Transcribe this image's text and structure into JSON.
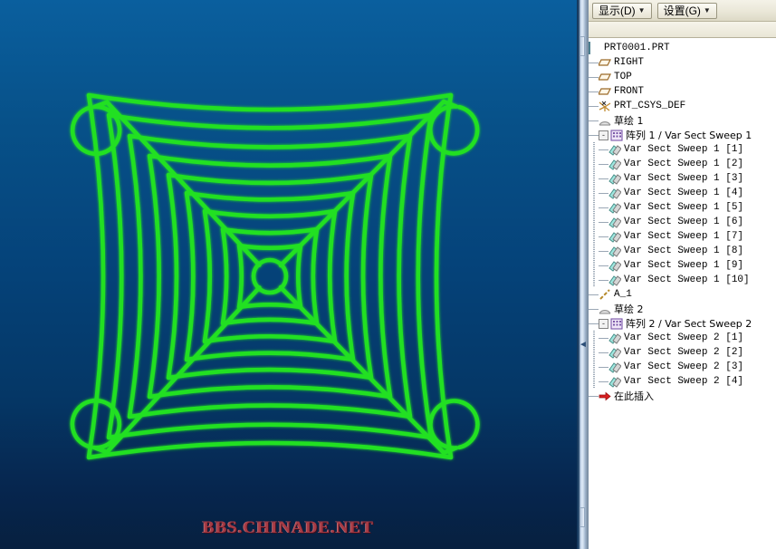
{
  "app": {
    "watermark": "BBS.CHINADE.NET",
    "viewport_name": "3d-graphics-view",
    "model_description": "green spider web swept feature"
  },
  "colors": {
    "background_top": "#0a5f9e",
    "background_bottom": "#07203f",
    "geometry_green": "#22e022",
    "watermark_red": "#a53a44",
    "panel_background": "#ffffff",
    "toolbar_background": "#eae7d8"
  },
  "toolbar": {
    "buttons": [
      {
        "label": "显示(D)",
        "caret": "▼",
        "name": "display-menu-button"
      },
      {
        "label": "设置(G)",
        "caret": "▼",
        "name": "settings-menu-button"
      }
    ]
  },
  "tree": {
    "items": [
      {
        "label": "PRT0001.PRT",
        "depth": 0,
        "icon": "part-icon",
        "expander": "",
        "mono": true
      },
      {
        "label": "RIGHT",
        "depth": 1,
        "icon": "plane-icon",
        "expander": "",
        "mono": true
      },
      {
        "label": "TOP",
        "depth": 1,
        "icon": "plane-icon",
        "expander": "",
        "mono": true
      },
      {
        "label": "FRONT",
        "depth": 1,
        "icon": "plane-icon",
        "expander": "",
        "mono": true
      },
      {
        "label": "PRT_CSYS_DEF",
        "depth": 1,
        "icon": "csys-icon",
        "expander": "",
        "mono": true
      },
      {
        "label": "草绘 1",
        "depth": 1,
        "icon": "sketch-icon",
        "expander": "",
        "mono": false
      },
      {
        "label": "阵列 1 / Var Sect Sweep 1",
        "depth": 1,
        "icon": "pattern-icon",
        "expander": "-",
        "mono": false
      },
      {
        "label": "Var Sect Sweep 1 [1]",
        "depth": 2,
        "icon": "sweep-icon",
        "expander": "",
        "mono": true
      },
      {
        "label": "Var Sect Sweep 1 [2]",
        "depth": 2,
        "icon": "sweep-icon",
        "expander": "",
        "mono": true
      },
      {
        "label": "Var Sect Sweep 1 [3]",
        "depth": 2,
        "icon": "sweep-icon",
        "expander": "",
        "mono": true
      },
      {
        "label": "Var Sect Sweep 1 [4]",
        "depth": 2,
        "icon": "sweep-icon",
        "expander": "",
        "mono": true
      },
      {
        "label": "Var Sect Sweep 1 [5]",
        "depth": 2,
        "icon": "sweep-icon",
        "expander": "",
        "mono": true
      },
      {
        "label": "Var Sect Sweep 1 [6]",
        "depth": 2,
        "icon": "sweep-icon",
        "expander": "",
        "mono": true
      },
      {
        "label": "Var Sect Sweep 1 [7]",
        "depth": 2,
        "icon": "sweep-icon",
        "expander": "",
        "mono": true
      },
      {
        "label": "Var Sect Sweep 1 [8]",
        "depth": 2,
        "icon": "sweep-icon",
        "expander": "",
        "mono": true
      },
      {
        "label": "Var Sect Sweep 1 [9]",
        "depth": 2,
        "icon": "sweep-icon",
        "expander": "",
        "mono": true
      },
      {
        "label": "Var Sect Sweep 1 [10]",
        "depth": 2,
        "icon": "sweep-icon",
        "expander": "",
        "mono": true
      },
      {
        "label": "A_1",
        "depth": 1,
        "icon": "axis-icon",
        "expander": "",
        "mono": true
      },
      {
        "label": "草绘 2",
        "depth": 1,
        "icon": "sketch-icon",
        "expander": "",
        "mono": false
      },
      {
        "label": "阵列 2 / Var Sect Sweep 2",
        "depth": 1,
        "icon": "pattern-icon",
        "expander": "-",
        "mono": false
      },
      {
        "label": "Var Sect Sweep 2 [1]",
        "depth": 2,
        "icon": "sweep-icon",
        "expander": "",
        "mono": true
      },
      {
        "label": "Var Sect Sweep 2 [2]",
        "depth": 2,
        "icon": "sweep-icon",
        "expander": "",
        "mono": true
      },
      {
        "label": "Var Sect Sweep 2 [3]",
        "depth": 2,
        "icon": "sweep-icon",
        "expander": "",
        "mono": true
      },
      {
        "label": "Var Sect Sweep 2 [4]",
        "depth": 2,
        "icon": "sweep-icon",
        "expander": "",
        "mono": true
      },
      {
        "label": "在此插入",
        "depth": 1,
        "icon": "insert-icon",
        "expander": "",
        "mono": false
      }
    ]
  },
  "splitter": {
    "collapse_arrow": "◄"
  }
}
